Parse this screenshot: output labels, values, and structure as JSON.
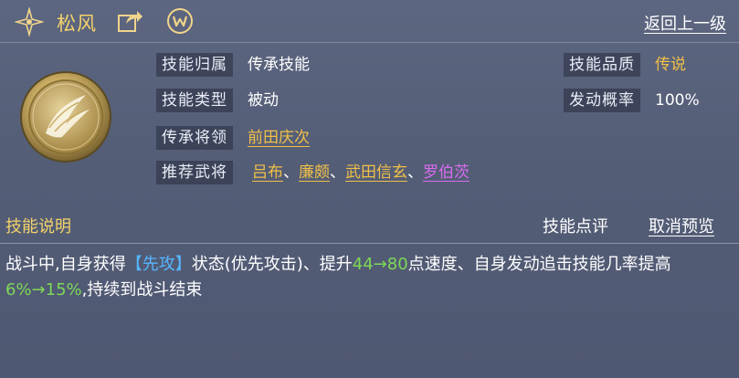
{
  "header": {
    "title": "松风",
    "back_label": "返回上一级"
  },
  "icons": {
    "star": "sparkle-star-icon",
    "share": "share-icon",
    "chat": "chat-bubble-icon",
    "emblem": "skill-emblem-icon"
  },
  "info": {
    "belong_label": "技能归属",
    "belong_value": "传承技能",
    "type_label": "技能类型",
    "type_value": "被动",
    "general_label": "传承将领",
    "general_value": "前田庆次",
    "recommend_label": "推荐武将",
    "recommend": [
      "吕布",
      "廉颇",
      "武田信玄",
      "罗伯茨"
    ],
    "separator": "、",
    "quality_label": "技能品质",
    "quality_value": "传说",
    "rate_label": "发动概率",
    "rate_value": "100%"
  },
  "section": {
    "title": "技能说明",
    "review_label": "技能点评",
    "cancel_preview_label": "取消预览"
  },
  "description": {
    "p1": "战斗中,自身获得",
    "keyword": "【先攻】",
    "p2": "状态(优先攻击)、提升",
    "speed_range": "44→80",
    "p3": "点速度、自身发动追击技能几率提高",
    "chance_range": "6%→15%",
    "p4": ",持续到战斗结束"
  },
  "colors": {
    "gold": "#f0c048",
    "title_gold": "#f3d36a",
    "purple": "#d66df0",
    "keyword_blue": "#56b6ff",
    "number_green": "#7ed957"
  }
}
